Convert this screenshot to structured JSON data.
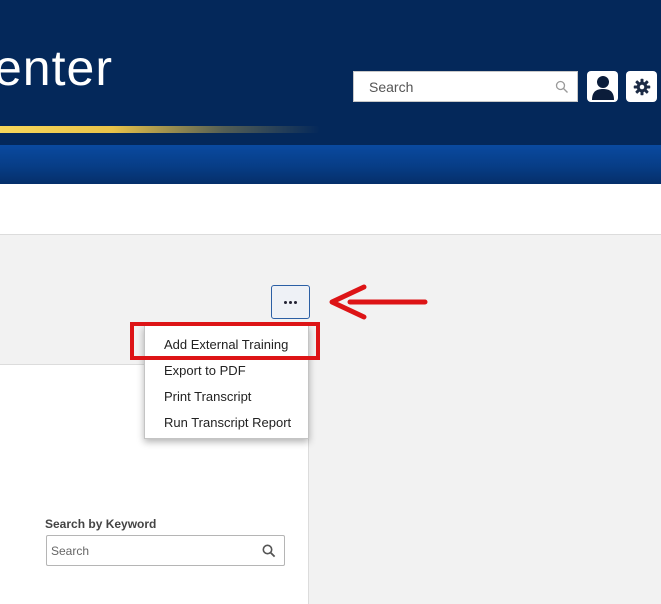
{
  "header": {
    "brand_text": "enter",
    "search_placeholder": "Search",
    "icons": [
      "search-icon",
      "user-icon",
      "gear-icon"
    ]
  },
  "toolbar": {
    "more_icon": "ellipsis-icon"
  },
  "dropdown": {
    "items": [
      {
        "label": "Add External Training"
      },
      {
        "label": "Export to PDF"
      },
      {
        "label": "Print Transcript"
      },
      {
        "label": "Run Transcript Report"
      }
    ]
  },
  "filters": {
    "keyword_label": "Search by Keyword",
    "keyword_placeholder": "Search"
  },
  "colors": {
    "header_bg": "#04285a",
    "accent_gold": "#e9c349",
    "nav_blue": "#073d86",
    "annotation_red": "#dd1416"
  }
}
